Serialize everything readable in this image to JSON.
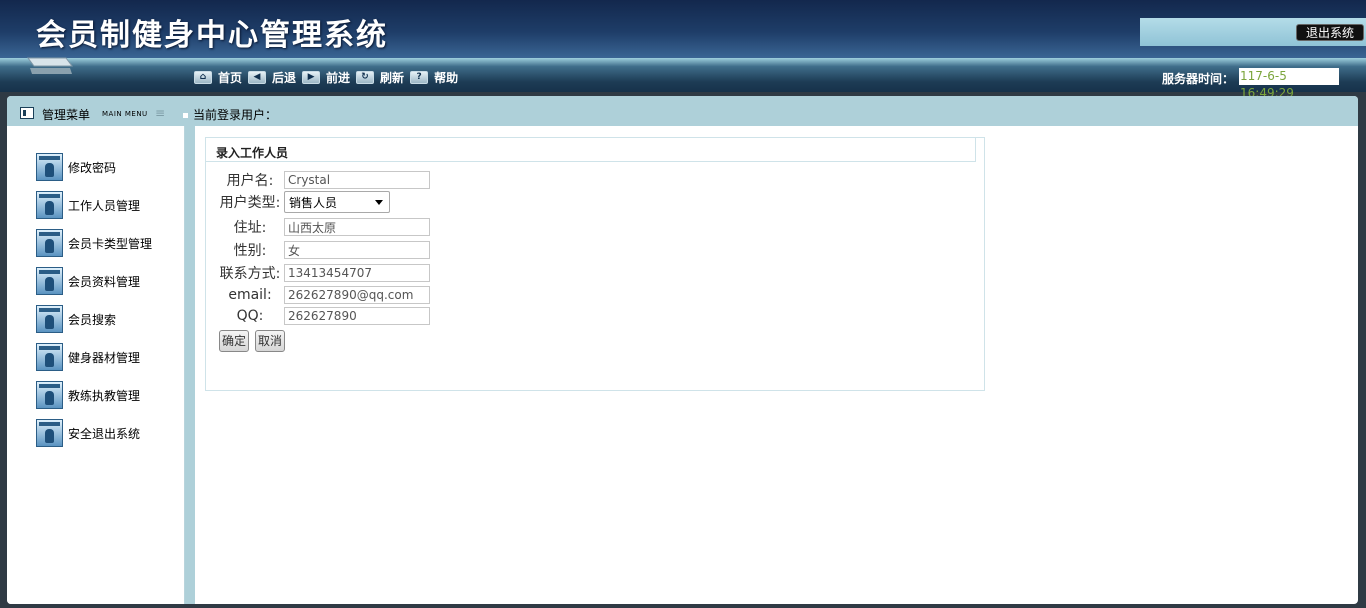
{
  "header": {
    "title": "会员制健身中心管理系统",
    "logout_label": "退出系统"
  },
  "nav": {
    "items": [
      {
        "icon": "home-icon",
        "label": "首页"
      },
      {
        "icon": "back-arrow-icon",
        "label": "后退"
      },
      {
        "icon": "forward-arrow-icon",
        "label": "前进"
      },
      {
        "icon": "refresh-icon",
        "label": "刷新"
      },
      {
        "icon": "help-icon",
        "label": "帮助"
      }
    ],
    "server_time_label": "服务器时间：",
    "server_time_value": "117-6-5 16:49:29"
  },
  "subheader": {
    "menu_title": "管理菜单",
    "menu_title_en": "MAIN MENU",
    "current_user_label": "当前登录用户："
  },
  "sidebar": {
    "items": [
      {
        "label": "修改密码"
      },
      {
        "label": "工作人员管理"
      },
      {
        "label": "会员卡类型管理"
      },
      {
        "label": "会员资料管理"
      },
      {
        "label": "会员搜索"
      },
      {
        "label": "健身器材管理"
      },
      {
        "label": "教练执教管理"
      },
      {
        "label": "安全退出系统"
      }
    ]
  },
  "form": {
    "title": "录入工作人员",
    "username": {
      "label": "用户名:",
      "value": "Crystal"
    },
    "user_type": {
      "label": "用户类型:",
      "value": "销售人员"
    },
    "address": {
      "label": "住址:",
      "value": "山西太原"
    },
    "gender": {
      "label": "性别:",
      "value": "女"
    },
    "contact": {
      "label": "联系方式:",
      "value": "13413454707"
    },
    "email": {
      "label": "email:",
      "value": "262627890@qq.com"
    },
    "qq": {
      "label": "QQ:",
      "value": "262627890"
    },
    "confirm_label": "确定",
    "cancel_label": "取消"
  },
  "colors": {
    "header_dark": "#13284d",
    "accent_light": "#aed0d9",
    "time_text": "#7ba53c"
  }
}
